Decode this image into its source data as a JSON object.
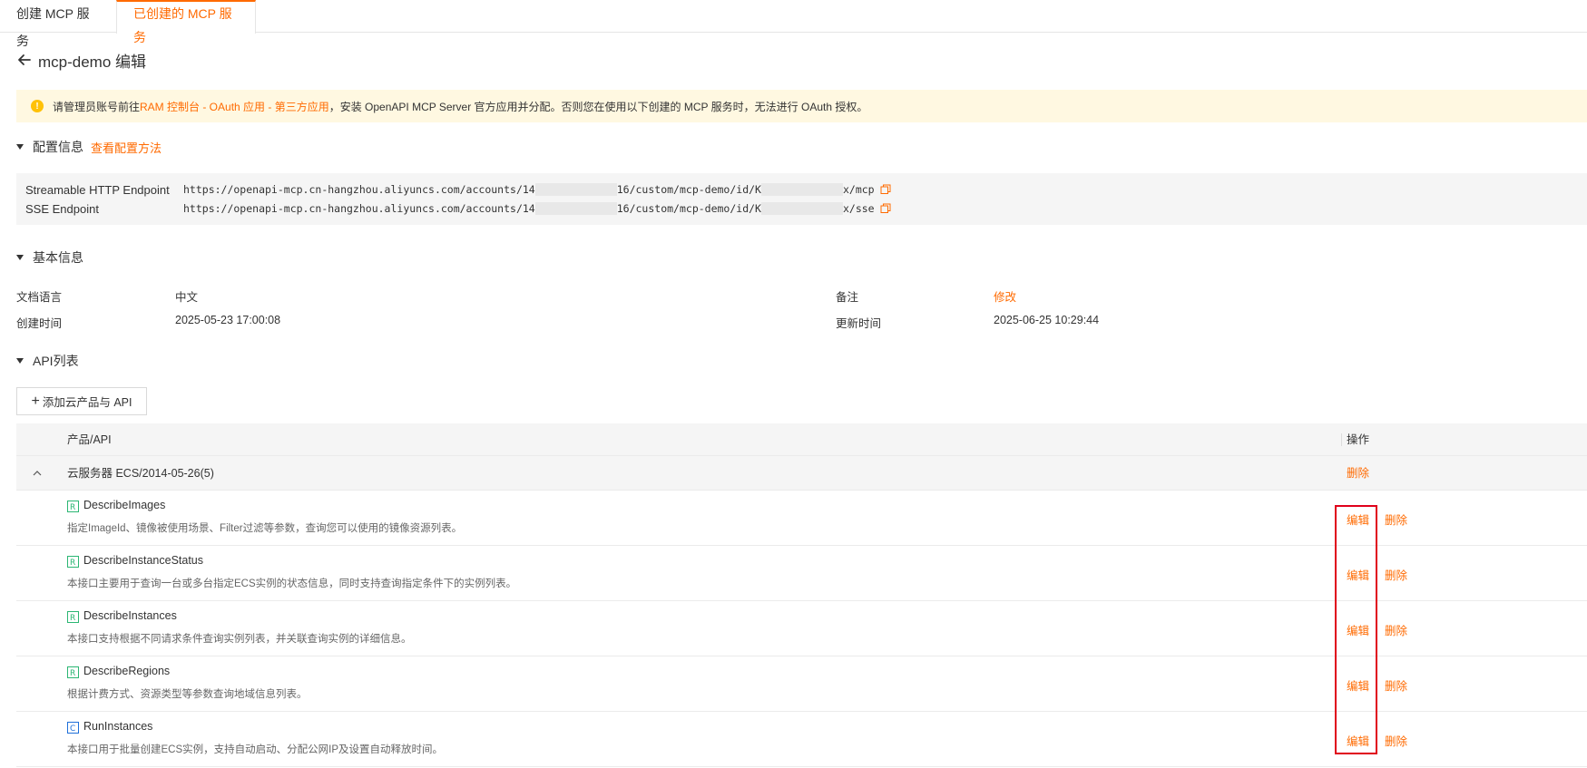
{
  "tabs": [
    {
      "label": "创建 MCP 服务",
      "active": false
    },
    {
      "label": "已创建的 MCP 服务",
      "active": true
    }
  ],
  "header": {
    "title": "mcp-demo 编辑"
  },
  "notice": {
    "prefix": "请管理员账号前往",
    "link": "RAM 控制台 - OAuth 应用 - 第三方应用",
    "suffix": "，安装 OpenAPI MCP Server 官方应用并分配。否则您在使用以下创建的 MCP 服务时，无法进行 OAuth 授权。"
  },
  "config": {
    "title": "配置信息",
    "link": "查看配置方法",
    "endpoints": [
      {
        "label": "Streamable HTTP Endpoint",
        "url_start": "https://openapi-mcp.cn-hangzhou.aliyuncs.com/accounts/14",
        "url_mid": "16/custom/mcp-demo/id/K",
        "url_end": "x/mcp"
      },
      {
        "label": "SSE Endpoint",
        "url_start": "https://openapi-mcp.cn-hangzhou.aliyuncs.com/accounts/14",
        "url_mid": "16/custom/mcp-demo/id/K",
        "url_end": "x/sse"
      }
    ]
  },
  "basic": {
    "title": "基本信息",
    "doc_lang_label": "文档语言",
    "doc_lang_value": "中文",
    "remark_label": "备注",
    "remark_link": "修改",
    "created_label": "创建时间",
    "created_value": "2025-05-23 17:00:08",
    "updated_label": "更新时间",
    "updated_value": "2025-06-25 10:29:44"
  },
  "api_list": {
    "title": "API列表",
    "add_button": "添加云产品与 API",
    "col_product": "产品/API",
    "col_action": "操作",
    "group": {
      "name": "云服务器 ECS/2014-05-26(5)",
      "delete": "删除"
    },
    "edit_label": "编辑",
    "delete_label": "删除",
    "apis": [
      {
        "icon": "read-api-icon",
        "name": "DescribeImages",
        "desc": "指定ImageId、镜像被使用场景、Filter过滤等参数，查询您可以使用的镜像资源列表。"
      },
      {
        "icon": "read-api-icon",
        "name": "DescribeInstanceStatus",
        "desc": "本接口主要用于查询一台或多台指定ECS实例的状态信息，同时支持查询指定条件下的实例列表。"
      },
      {
        "icon": "read-api-icon",
        "name": "DescribeInstances",
        "desc": "本接口支持根据不同请求条件查询实例列表，并关联查询实例的详细信息。"
      },
      {
        "icon": "read-api-icon",
        "name": "DescribeRegions",
        "desc": "根据计费方式、资源类型等参数查询地域信息列表。"
      },
      {
        "icon": "create-api-icon",
        "name": "RunInstances",
        "desc": "本接口用于批量创建ECS实例，支持自动启动、分配公网IP及设置自动释放时间。"
      }
    ]
  },
  "colors": {
    "accent": "#ff6a00",
    "notice_bg": "#fff8e1",
    "highlight": "#e0001b"
  }
}
